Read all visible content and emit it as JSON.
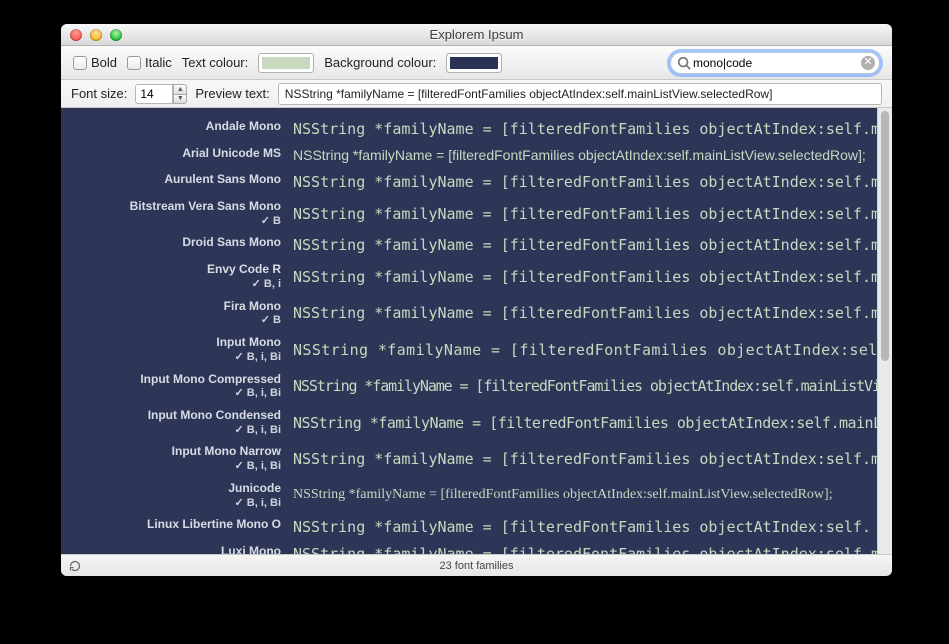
{
  "window": {
    "title": "Explorem Ipsum"
  },
  "toolbar": {
    "bold_label": "Bold",
    "italic_label": "Italic",
    "text_color_label": "Text colour:",
    "bg_color_label": "Background colour:",
    "text_swatch": "#c9d9c0",
    "bg_swatch": "#2a3354",
    "search_value": "mono|code",
    "font_size_label": "Font size:",
    "font_size_value": "14",
    "preview_text_label": "Preview text:",
    "preview_text_value": "NSString *familyName = [filteredFontFamilies objectAtIndex:self.mainListView.selectedRow]"
  },
  "list": {
    "preview_mono_1": "NSString *familyName = [filteredFontFamilies objectAtIndex:self.main",
    "preview_mono_long": "NSString *familyName = [filteredFontFamilies objectAtIndex:self.mainListView",
    "preview_mono_longf": "NSString *familyName = [filteredFontFamilies objectAtIndex:self.mainListView.",
    "preview_mono_short": "NSString *familyName = [filteredFontFamilies objectAtIndex:self.m",
    "preview_mono_list": "NSString *familyName = [filteredFontFamilies objectAtIndex:self.mainList",
    "preview_mono_self": "NSString *familyName = [filteredFontFamilies objectAtIndex:self.",
    "preview_sans_full": "NSString *familyName = [filteredFontFamilies objectAtIndex:self.mainListView.selectedRow];",
    "preview_serif_full": "NSString *familyName = [filteredFontFamilies objectAtIndex:self.mainListView.selectedRow];",
    "items": [
      {
        "name": "Andale Mono",
        "styles": ""
      },
      {
        "name": "Arial Unicode MS",
        "styles": ""
      },
      {
        "name": "Aurulent Sans Mono",
        "styles": ""
      },
      {
        "name": "Bitstream Vera Sans Mono",
        "styles": "✓ B"
      },
      {
        "name": "Droid Sans Mono",
        "styles": ""
      },
      {
        "name": "Envy Code R",
        "styles": "✓ B, i"
      },
      {
        "name": "Fira Mono",
        "styles": "✓ B"
      },
      {
        "name": "Input Mono",
        "styles": "✓ B, i, Bi"
      },
      {
        "name": "Input Mono Compressed",
        "styles": "✓ B, i, Bi"
      },
      {
        "name": "Input Mono Condensed",
        "styles": "✓ B, i, Bi"
      },
      {
        "name": "Input Mono Narrow",
        "styles": "✓ B, i, Bi"
      },
      {
        "name": "Junicode",
        "styles": "✓ B, i, Bi"
      },
      {
        "name": "Linux Libertine Mono O",
        "styles": ""
      },
      {
        "name": "Luxi Mono",
        "styles": ""
      }
    ]
  },
  "status": {
    "text": "23 font families"
  }
}
